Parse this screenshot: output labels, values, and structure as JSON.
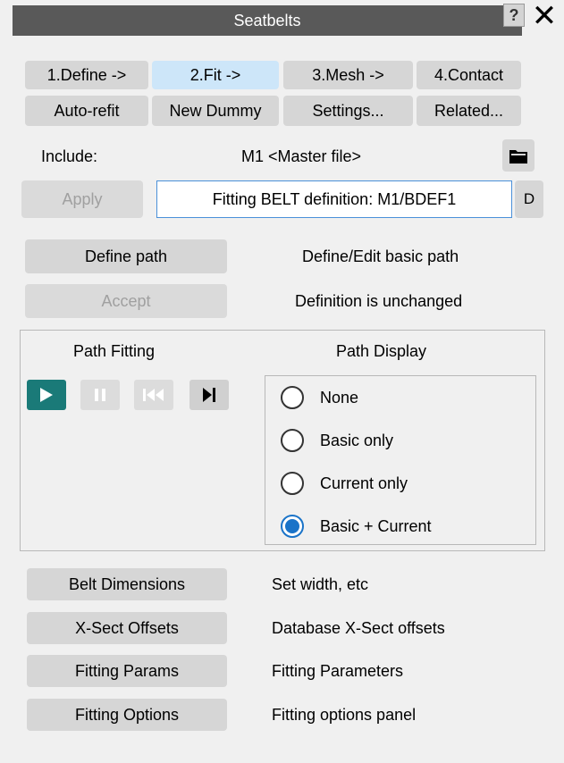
{
  "window": {
    "title": "Seatbelts",
    "help": "?",
    "close": "✕"
  },
  "steps": [
    "1.Define ->",
    "2.Fit ->",
    "3.Mesh ->",
    "4.Contact"
  ],
  "actions": [
    "Auto-refit",
    "New Dummy",
    "Settings...",
    "Related..."
  ],
  "include": {
    "label": "Include:",
    "value": "M1  <Master file>"
  },
  "apply": {
    "label": "Apply",
    "field": "Fitting BELT definition: M1/BDEF1",
    "d_button": "D"
  },
  "define_path": {
    "button": "Define path",
    "description": "Define/Edit basic path"
  },
  "accept": {
    "button": "Accept",
    "description": "Definition is unchanged"
  },
  "path_fitting": {
    "title": "Path Fitting"
  },
  "path_display": {
    "title": "Path Display",
    "options": [
      "None",
      "Basic only",
      "Current only",
      "Basic + Current"
    ],
    "selected": "Basic + Current"
  },
  "bottom_rows": [
    {
      "button": "Belt Dimensions",
      "description": "Set width, etc"
    },
    {
      "button": "X-Sect Offsets",
      "description": "Database X-Sect offsets"
    },
    {
      "button": "Fitting Params",
      "description": "Fitting Parameters"
    },
    {
      "button": "Fitting Options",
      "description": "Fitting options panel"
    }
  ],
  "colors": {
    "titlebar": "#595959",
    "play": "#1a7a78",
    "active_tab": "#cde6f9",
    "radio_selected": "#1a73c8"
  }
}
